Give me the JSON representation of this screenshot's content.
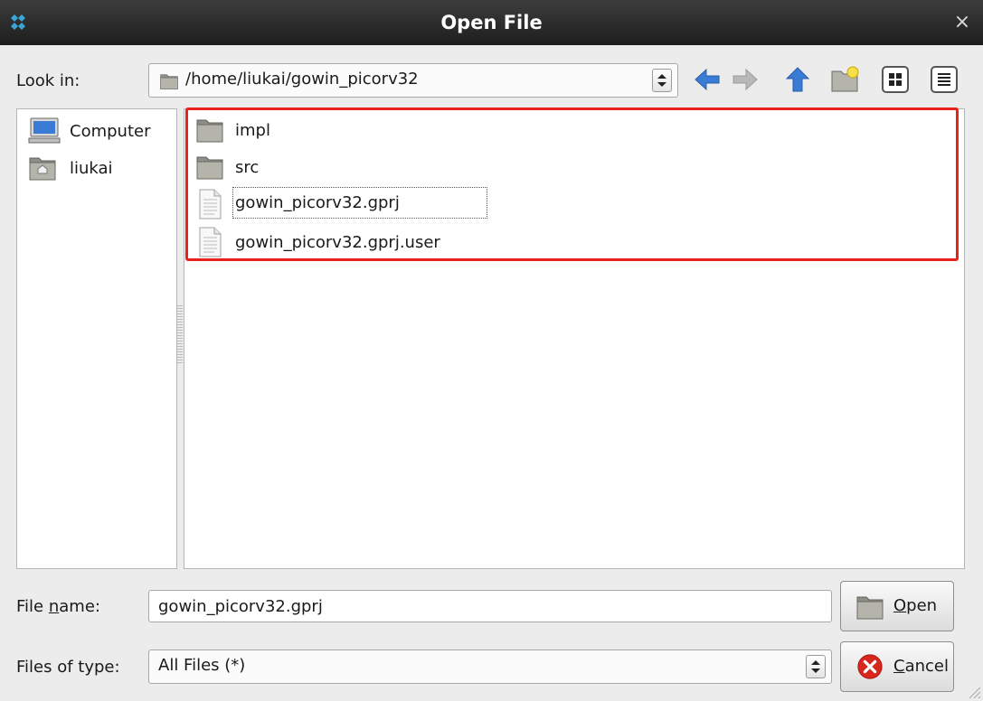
{
  "window": {
    "title": "Open File",
    "close_glyph": "×",
    "app_icon": "gowin-logo-icon"
  },
  "look_in": {
    "label": "Look in:",
    "path": "/home/liukai/gowin_picorv32",
    "spin_glyph": "⬍"
  },
  "toolbar": {
    "back_icon": "arrow-left-icon",
    "forward_icon": "arrow-right-icon",
    "up_icon": "arrow-up-icon",
    "new_folder_icon": "new-folder-icon",
    "list_view_icon": "list-view-icon",
    "detail_view_icon": "detail-view-icon"
  },
  "sidebar": {
    "items": [
      {
        "label": "Computer",
        "icon": "computer-icon"
      },
      {
        "label": "liukai",
        "icon": "home-folder-icon"
      }
    ]
  },
  "files": {
    "items": [
      {
        "name": "impl",
        "icon": "folder-icon"
      },
      {
        "name": "src",
        "icon": "folder-icon"
      },
      {
        "name": "gowin_picorv32.gprj",
        "icon": "file-icon"
      },
      {
        "name": "gowin_picorv32.gprj.user",
        "icon": "file-icon"
      }
    ]
  },
  "file_name": {
    "label_pre": "File ",
    "label_mnemonic": "n",
    "label_post": "ame:",
    "value": "gowin_picorv32.gprj"
  },
  "file_type": {
    "label": "Files of type:",
    "value": "All Files (*)"
  },
  "buttons": {
    "open_mnemonic": "O",
    "open_rest": "pen",
    "cancel_mnemonic": "C",
    "cancel_rest": "ancel"
  },
  "colors": {
    "accent_blue": "#3a7bd5",
    "highlight_red": "#e8211b",
    "cancel_red": "#d9261c"
  }
}
